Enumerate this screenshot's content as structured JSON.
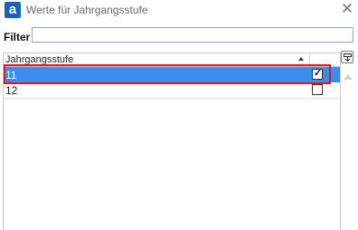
{
  "window": {
    "title": "Werte für Jahrgangsstufe",
    "app_icon_letter": "a",
    "close_glyph": "✕"
  },
  "filter": {
    "label": "Filter",
    "value": "",
    "placeholder": ""
  },
  "grid": {
    "column_header": "Jahrgangsstufe",
    "sort": "ascending",
    "rows": [
      {
        "label": "11",
        "checked": true,
        "selected": true
      },
      {
        "label": "12",
        "checked": false,
        "selected": false
      }
    ]
  },
  "icons": {
    "app": "app-logo-icon",
    "close": "close-icon",
    "side_button": "export-list-icon",
    "scroll": "scroll-up-icon"
  },
  "colors": {
    "selection": "#3b8ef0",
    "highlight": "#e01818",
    "brand": "#1565c0"
  }
}
